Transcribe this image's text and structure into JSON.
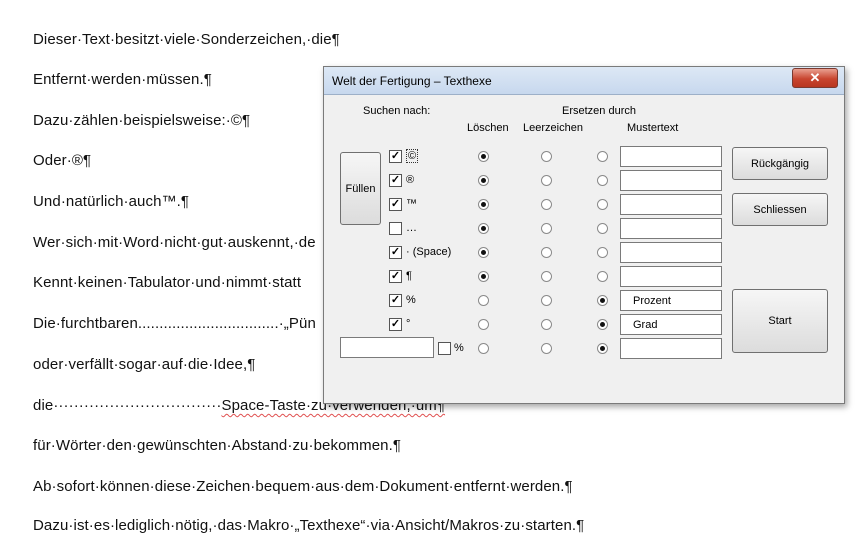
{
  "document": {
    "lines": [
      "Dieser·Text·besitzt·viele·Sonderzeichen,·die¶",
      "Entfernt·werden·müssen.¶",
      "Dazu·zählen·beispielsweise:·©¶",
      "Oder·®¶",
      "Und·natürlich·auch™.¶",
      "Wer·sich·mit·Word·nicht·gut·auskennt,·de",
      "Kennt·keinen·Tabulator·und·nimmt·statt",
      "Die·furchtbaren.................................·„Pün",
      "oder·verfällt·sogar·auf·die·Idee,¶",
      "die·································Space-Taste·zu·verwenden,·um¶",
      "für·Wörter·den·gewünschten·Abstand·zu·bekommen.¶",
      "Ab·sofort·können·diese·Zeichen·bequem·aus·dem·Dokument·entfernt·werden.¶",
      "Dazu·ist·es·lediglich·nötig,·das·Makro·„Texthexe“·via·Ansicht/Makros·zu·starten.¶"
    ],
    "line9_prefix": "die·································",
    "line9_squiggle": "Space-Taste·zu·verwenden,·um¶"
  },
  "dialog": {
    "title": "Welt der Fertigung – Texthexe",
    "close_label": "✕",
    "headers": {
      "search": "Suchen nach:",
      "replace": "Ersetzen durch",
      "delete": "Löschen",
      "space": "Leerzeichen",
      "pattern": "Mustertext"
    },
    "buttons": {
      "fill": "Füllen",
      "undo": "Rückgängig",
      "close": "Schliessen",
      "start": "Start"
    },
    "rows": [
      {
        "checked": true,
        "symbol": "©",
        "choice": 1,
        "text": ""
      },
      {
        "checked": true,
        "symbol": "®",
        "choice": 1,
        "text": ""
      },
      {
        "checked": true,
        "symbol": "™",
        "choice": 1,
        "text": ""
      },
      {
        "checked": false,
        "symbol": "…",
        "choice": 1,
        "text": ""
      },
      {
        "checked": true,
        "symbol": "· (Space)",
        "choice": 1,
        "text": ""
      },
      {
        "checked": true,
        "symbol": "¶",
        "choice": 1,
        "text": ""
      },
      {
        "checked": true,
        "symbol": "%",
        "choice": 3,
        "text": "Prozent"
      },
      {
        "checked": true,
        "symbol": "°",
        "choice": 3,
        "text": "Grad"
      }
    ],
    "custom_row": {
      "input_value": "",
      "checked": false,
      "percent_label": "%",
      "choice": 3,
      "text": ""
    },
    "check_mark": "✓"
  }
}
